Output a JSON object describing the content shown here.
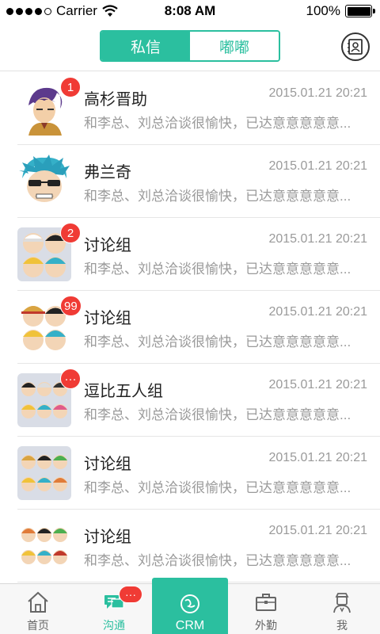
{
  "status_bar": {
    "carrier": "Carrier",
    "time": "8:08 AM",
    "battery": "100%",
    "battery_level": 1.0
  },
  "header": {
    "tabs": [
      {
        "label": "私信",
        "active": true
      },
      {
        "label": "嘟嘟",
        "active": false
      }
    ],
    "contacts_icon": "contacts-icon",
    "accent_color": "#2bbf9f"
  },
  "conversations": [
    {
      "name": "高杉晋助",
      "time": "2015.01.21 20:21",
      "preview": "和李总、刘总洽谈很愉快，已达意意意意意...",
      "badge": "1",
      "avatar": "single-avatar"
    },
    {
      "name": "弗兰奇",
      "time": "2015.01.21 20:21",
      "preview": "和李总、刘总洽谈很愉快，已达意意意意意...",
      "badge": "",
      "avatar": "single-avatar"
    },
    {
      "name": "讨论组",
      "time": "2015.01.21 20:21",
      "preview": "和李总、刘总洽谈很愉快，已达意意意意意...",
      "badge": "2",
      "avatar": "group-avatar"
    },
    {
      "name": "讨论组",
      "time": "2015.01.21 20:21",
      "preview": "和李总、刘总洽谈很愉快，已达意意意意意...",
      "badge": "99",
      "avatar": "group-avatar"
    },
    {
      "name": "逗比五人组",
      "time": "2015.01.21 20:21",
      "preview": "和李总、刘总洽谈很愉快，已达意意意意意...",
      "badge": "···",
      "avatar": "group-avatar"
    },
    {
      "name": "讨论组",
      "time": "2015.01.21 20:21",
      "preview": "和李总、刘总洽谈很愉快，已达意意意意意...",
      "badge": "",
      "avatar": "group-avatar"
    },
    {
      "name": "讨论组",
      "time": "2015.01.21 20:21",
      "preview": "和李总、刘总洽谈很愉快，已达意意意意意...",
      "badge": "",
      "avatar": "group-avatar"
    }
  ],
  "tabbar": {
    "items": [
      {
        "label": "首页",
        "icon": "home-icon"
      },
      {
        "label": "沟通",
        "icon": "chat-icon",
        "badge": "···",
        "active": true
      },
      {
        "label": "CRM",
        "icon": "crm-icon"
      },
      {
        "label": "外勤",
        "icon": "briefcase-icon"
      },
      {
        "label": "我",
        "icon": "profile-icon"
      }
    ]
  }
}
